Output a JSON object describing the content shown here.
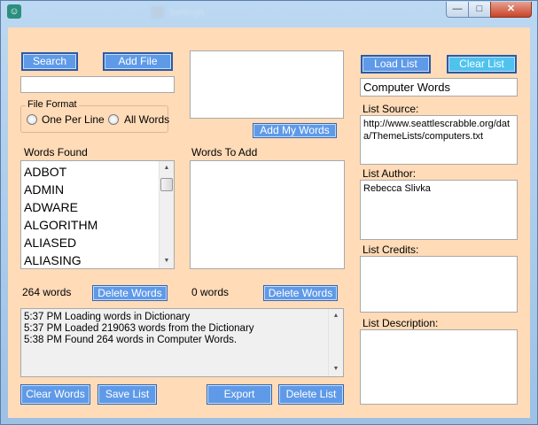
{
  "window": {
    "title": "Settings",
    "controls": {
      "minimize": "—",
      "maximize": "□",
      "close": "✕"
    },
    "icon": "owl-icon"
  },
  "search": {
    "button_label": "Search",
    "input_value": ""
  },
  "add_file": {
    "button_label": "Add File"
  },
  "file_format": {
    "title": "File Format",
    "options": [
      "One Per Line",
      "All Words"
    ],
    "selected": null
  },
  "add_my_words": {
    "button_label": "Add My Words",
    "input_value": ""
  },
  "words_found": {
    "label": "Words Found",
    "items": [
      "ADBOT",
      "ADMIN",
      "ADWARE",
      "ALGORITHM",
      "ALIASED",
      "ALIASING"
    ],
    "count_text": "264 words",
    "delete_label": "Delete Words"
  },
  "words_to_add": {
    "label": "Words To Add",
    "items": [],
    "count_text": "0 words",
    "delete_label": "Delete Words"
  },
  "log": {
    "lines": [
      "5:37 PM Loading words in Dictionary",
      "5:37 PM Loaded 219063 words from the Dictionary",
      "5:38 PM Found 264 words in Computer Words."
    ]
  },
  "bottom_buttons": {
    "clear_words": "Clear Words",
    "save_list": "Save List",
    "export": "Export",
    "delete_list": "Delete List"
  },
  "right_panel": {
    "load_list": "Load List",
    "clear_list": "Clear List",
    "list_name": "Computer Words",
    "source_label": "List Source:",
    "source_value": "http://www.seattlescrabble.org/data/ThemeLists/computers.txt",
    "author_label": "List Author:",
    "author_value": "Rebecca Slivka",
    "credits_label": "List Credits:",
    "credits_value": "",
    "description_label": "List Description:",
    "description_value": ""
  },
  "colors": {
    "client_background": "#ffdbb8",
    "button_blue": "#5f9ae8",
    "button_selected": "#4ec3ee"
  }
}
